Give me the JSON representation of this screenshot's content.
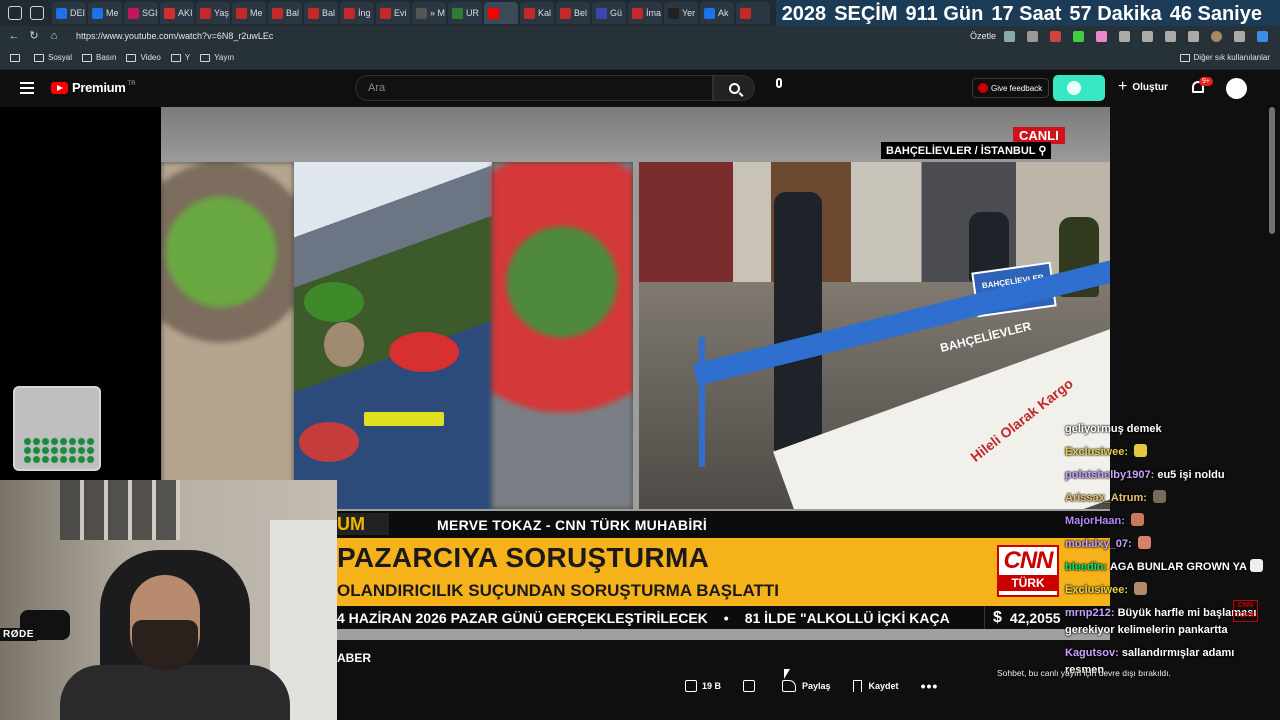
{
  "browser": {
    "tabs": [
      {
        "label": "DEI",
        "color": "#1a73e8"
      },
      {
        "label": "Me",
        "color": "#1a73e8"
      },
      {
        "label": "SGI",
        "color": "#c2185b"
      },
      {
        "label": "AKI",
        "color": "#d32f2f"
      },
      {
        "label": "Yaş",
        "color": "#c62828"
      },
      {
        "label": "Me",
        "color": "#c62828"
      },
      {
        "label": "Bal",
        "color": "#c62828"
      },
      {
        "label": "Bal",
        "color": "#c62828"
      },
      {
        "label": "İng",
        "color": "#c62828"
      },
      {
        "label": "Evi",
        "color": "#c62828"
      },
      {
        "label": "» M",
        "color": "#555555"
      },
      {
        "label": "UR",
        "color": "#2e7d32"
      },
      {
        "label": "",
        "color": "#ff0000",
        "active": true
      },
      {
        "label": "Kal",
        "color": "#c62828"
      },
      {
        "label": "Bel",
        "color": "#c62828"
      },
      {
        "label": "Gü",
        "color": "#3949ab"
      },
      {
        "label": "İma",
        "color": "#c62828"
      },
      {
        "label": "Yer",
        "color": "#212121"
      },
      {
        "label": "Ak",
        "color": "#1a73e8"
      },
      {
        "label": "",
        "color": "#c62828"
      }
    ],
    "countdown": [
      "2028",
      "SEÇİM",
      "911 Gün",
      "17 Saat",
      "57 Dakika",
      "46 Saniye"
    ],
    "url": "https://www.youtube.com/watch?v=6N8_r2uwLEc",
    "summarize_label": "Özetle",
    "bookmarks": [
      "Sosyal",
      "Basın",
      "Video",
      "Y",
      "Yayın"
    ],
    "other_bookmarks": "Diğer sık kullanılanlar"
  },
  "youtube": {
    "logo_text": "Premium",
    "logo_region": "TR",
    "search_placeholder": "Ara",
    "feedback_label": "Give feedback",
    "create_label": "Oluştur",
    "notification_count": "9+"
  },
  "video": {
    "live_label": "CANLI",
    "location": "BAHÇELİEVLER / İSTANBUL",
    "lower_third_tag": "UM",
    "reporter": "MERVE TOKAZ - CNN TÜRK MUHABİRİ",
    "headline": "PAZARCIYA SORUŞTURMA",
    "subheadline": "OLANDIRICILIK SUÇUNDAN SORUŞTURMA BAŞLATTI",
    "channel_logo_top": "CNN",
    "channel_logo_bottom": "TÜRK",
    "ticker_items": [
      "4 HAZİRAN 2026 PAZAR GÜNÜ GERÇEKLEŞTİRİLECEK",
      "81 İLDE \"ALKOLLÜ İÇKİ KAÇA"
    ],
    "ticker_separator": "•",
    "currency_symbol": "$",
    "currency_value": "42,2055",
    "banner_text": "Hileli Olarak Kargo",
    "barrier_text": "BAHÇELİEVLER",
    "sign_text": "BAHÇELİEVLER BELEDİYESİ ZABITA"
  },
  "below_video": {
    "title": "ABER",
    "like_count": "19 B",
    "share_label": "Paylaş",
    "save_label": "Kaydet",
    "more_label": "•••"
  },
  "overlay": {
    "mic_brand": "RØDE"
  },
  "chat": {
    "messages": [
      {
        "user": "",
        "user_color": "#ffffff",
        "text": "geliyormuş demek",
        "emote": ""
      },
      {
        "user": "Exclusiwee:",
        "user_color": "#e6d24a",
        "text": "",
        "emote": "#e8c840"
      },
      {
        "user": "polatshelby1907:",
        "user_color": "#c9a0ff",
        "text": "eu5 işi noldu",
        "emote": ""
      },
      {
        "user": "Arissax_Atrum:",
        "user_color": "#e9c46a",
        "text": "",
        "emote": "#7a6a5a"
      },
      {
        "user": "MajorHaan:",
        "user_color": "#b388ff",
        "text": "",
        "emote": "#c97a5a"
      },
      {
        "user": "modalxy_07:",
        "user_color": "#c9a0ff",
        "text": "",
        "emote": "#d9826a"
      },
      {
        "user": "bleedin:",
        "user_color": "#00e676",
        "text": "AGA BUNLAR GROWN YA",
        "emote": "#eeeeee"
      },
      {
        "user": "Exclusiwee:",
        "user_color": "#e6d24a",
        "text": "",
        "emote": "#b08a6a"
      },
      {
        "user": "mrnp212:",
        "user_color": "#c9a0ff",
        "text": "Büyük harfle mi başlaması gerekiyor kelimelerin pankartta",
        "emote": ""
      },
      {
        "user": "Kagutsov:",
        "user_color": "#c9a0ff",
        "text": "sallandırmışlar adamı resmen",
        "emote": ""
      }
    ],
    "notice": "Sohbet, bu canlı yayın için devre dışı bırakıldı.",
    "cnn_small": "CNN TÜRK"
  }
}
